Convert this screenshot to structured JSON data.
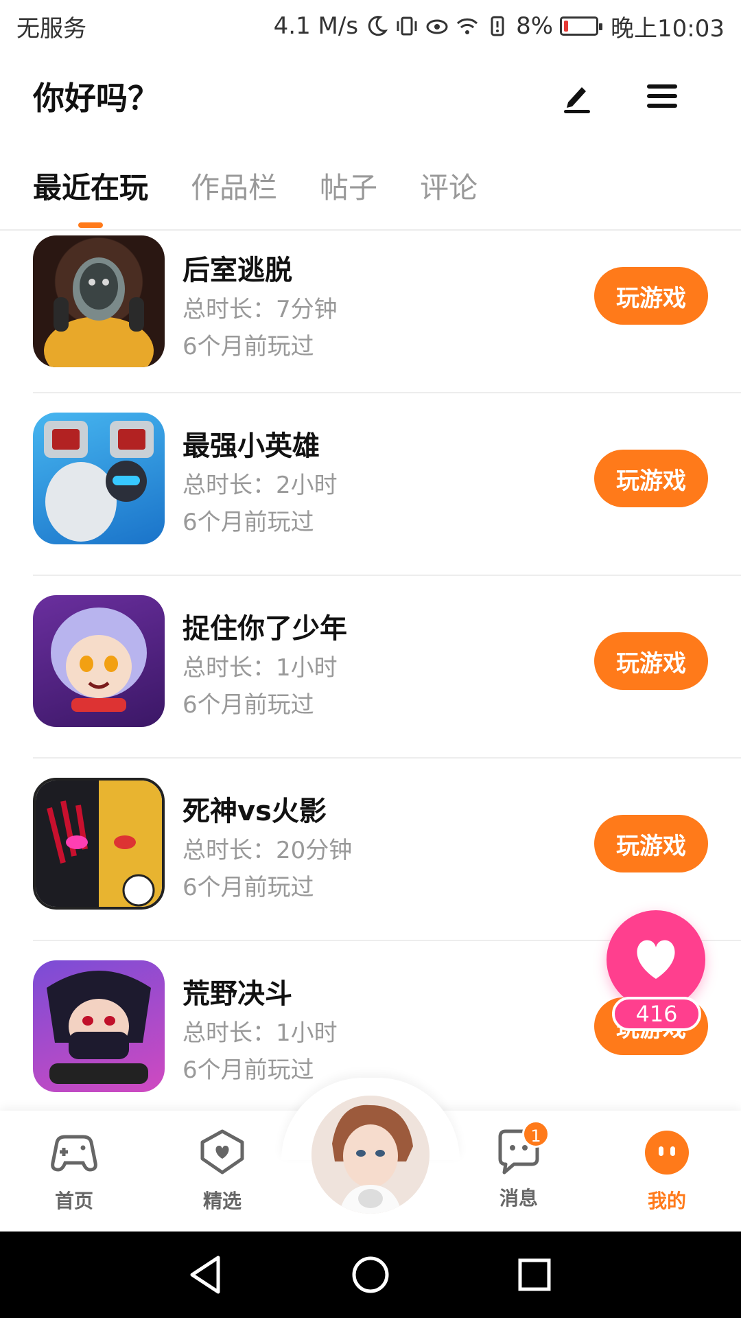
{
  "status_bar": {
    "carrier": "无服务",
    "speed": "4.1 M/s",
    "battery_pct": "8%",
    "time": "晚上10:03"
  },
  "header": {
    "title": "你好吗？"
  },
  "tabs": [
    {
      "label": "最近在玩",
      "active": true
    },
    {
      "label": "作品栏"
    },
    {
      "label": "帖子"
    },
    {
      "label": "评论"
    }
  ],
  "games": [
    {
      "name": "后室逃脱",
      "duration": "总时长：7分钟",
      "last_played": "6个月前玩过",
      "button": "玩游戏"
    },
    {
      "name": "最强小英雄",
      "duration": "总时长：2小时",
      "last_played": "6个月前玩过",
      "button": "玩游戏"
    },
    {
      "name": "捉住你了少年",
      "duration": "总时长：1小时",
      "last_played": "6个月前玩过",
      "button": "玩游戏"
    },
    {
      "name": "死神vs火影",
      "duration": "总时长：20分钟",
      "last_played": "6个月前玩过",
      "button": "玩游戏"
    },
    {
      "name": "荒野决斗",
      "duration": "总时长：1小时",
      "last_played": "6个月前玩过",
      "button": "玩游戏"
    }
  ],
  "fab": {
    "icon": "heart-icon",
    "count": "416"
  },
  "bottom_nav": [
    {
      "label": "首页",
      "icon": "gamepad-icon"
    },
    {
      "label": "精选",
      "icon": "heart-chat-icon"
    },
    {
      "label": "",
      "icon": "avatar"
    },
    {
      "label": "消息",
      "icon": "message-icon",
      "badge": "1"
    },
    {
      "label": "我的",
      "icon": "profile-icon",
      "active": true
    }
  ],
  "colors": {
    "accent": "#ff7a1a",
    "fab": "#ff3f8e",
    "muted_text": "#999999"
  }
}
